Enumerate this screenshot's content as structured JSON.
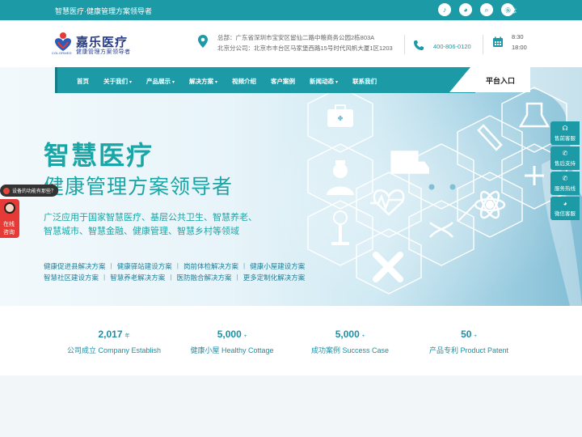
{
  "topbar": {
    "tagline": "智慧医疗·健康管理方案领导者",
    "icons": [
      "bell-icon",
      "wechat-icon",
      "search-icon",
      "weibo-icon"
    ],
    "lang": "繁体"
  },
  "header": {
    "logo_title": "嘉乐医疗",
    "logo_slogan": "健康管理方案领导者",
    "logo_sub": "COLORMED",
    "address_main": "总部：广东省深圳市宝安区留仙二路中粮商务公园2栋803A",
    "address_branch": "北京分公司：北京市丰台区马家堡西路15号时代风帆大厦1区1203",
    "phone": "400-806-0120",
    "hours_start": "8:30",
    "hours_end": "18:00"
  },
  "nav": {
    "items": [
      {
        "label": "首页",
        "dropdown": false
      },
      {
        "label": "关于我们",
        "dropdown": true
      },
      {
        "label": "产品展示",
        "dropdown": true
      },
      {
        "label": "解决方案",
        "dropdown": true
      },
      {
        "label": "视频介绍",
        "dropdown": false
      },
      {
        "label": "客户案例",
        "dropdown": false
      },
      {
        "label": "新闻动态",
        "dropdown": true
      },
      {
        "label": "联系我们",
        "dropdown": false
      }
    ],
    "platform_label": "平台入口"
  },
  "hero": {
    "title": "智慧医疗",
    "subtitle": "健康管理方案领导者",
    "desc_line1": "广泛应用于国家智慧医疗、基层公共卫生、智慧养老、",
    "desc_line2": "智慧城市、智慧金融、健康管理、智慧乡村等领域",
    "solutions_row1": [
      "健康促进县解决方案",
      "健康驿站建设方案",
      "岗前体检解决方案",
      "健康小屋建设方案"
    ],
    "solutions_row2": [
      "智慧社区建设方案",
      "智慧养老解决方案",
      "医防融合解决方案",
      "更多定制化解决方案"
    ]
  },
  "floating": {
    "popup_text": "设备的功能有那些？",
    "consult_line1": "在线",
    "consult_line2": "咨询"
  },
  "side_service": [
    {
      "icon": "headset-icon",
      "label": "售前客服"
    },
    {
      "icon": "phone-icon",
      "label": "售后支持"
    },
    {
      "icon": "phone-icon",
      "label": "服务热线"
    },
    {
      "icon": "wechat-icon",
      "label": "微信客服"
    }
  ],
  "stats": [
    {
      "value": "2,017",
      "suffix": "年",
      "label": "公司成立 Company Establish"
    },
    {
      "value": "5,000",
      "suffix": "+",
      "label": "健康小屋 Healthy Cottage"
    },
    {
      "value": "5,000",
      "suffix": "+",
      "label": "成功案例 Success Case"
    },
    {
      "value": "50",
      "suffix": "+",
      "label": "产品专利 Product Patent"
    }
  ],
  "colors": {
    "primary": "#1c9aa5",
    "brand_blue": "#243b8c",
    "hero_text": "#1aa6a6",
    "consult_red": "#e53a35"
  }
}
